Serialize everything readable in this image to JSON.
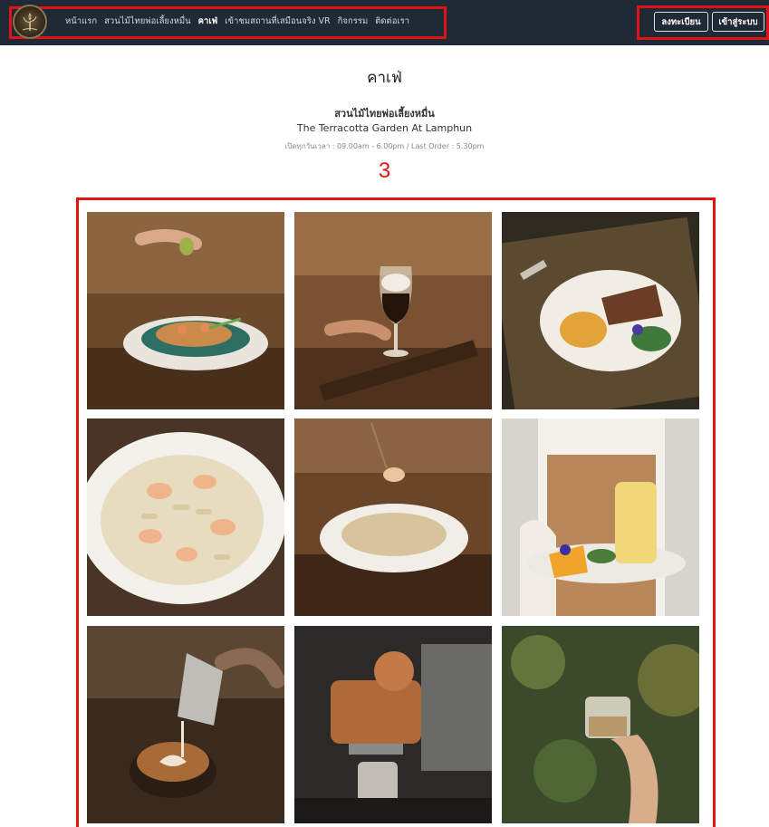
{
  "navbar": {
    "links": [
      "หน้าแรก",
      "สวนไม้ไทยพ่อเลี้ยงหมื่น",
      "คาเฟ่",
      "เข้าชมสถานที่เสมือนจริง VR",
      "กิจกรรม",
      "ติดต่อเรา"
    ],
    "active_link": "คาเฟ่",
    "register_label": "ลงทะเบียน",
    "login_label": "เข้าสู่ระบบ"
  },
  "page": {
    "title": "คาเฟ่",
    "subtitle_th": "สวนไม้ไทยพ่อเลี้ยงหมื่น",
    "subtitle_en": "The Terracotta Garden At Lamphun",
    "hours": "เปิดทุกวันเวลา : 09.00am - 6.00pm / Last Order : 5.30pm"
  },
  "annotation": {
    "marker": "3"
  },
  "gallery": {
    "items": [
      {
        "icon": "pad-thai-photo"
      },
      {
        "icon": "iced-coffee-photo"
      },
      {
        "icon": "steak-rice-photo"
      },
      {
        "icon": "shrimp-penne-photo"
      },
      {
        "icon": "pasta-fork-photo"
      },
      {
        "icon": "mango-smoothie-photo"
      },
      {
        "icon": "latte-art-photo"
      },
      {
        "icon": "espresso-machine-photo"
      },
      {
        "icon": "iced-drink-photo"
      }
    ]
  }
}
